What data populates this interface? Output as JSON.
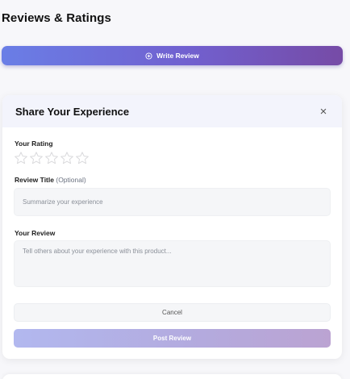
{
  "page": {
    "title": "Reviews & Ratings"
  },
  "write_review_button": {
    "label": "Write Review",
    "icon": "circle-plus-icon"
  },
  "review_form": {
    "title": "Share Your Experience",
    "close_icon": "close-icon",
    "close_glyph": "×",
    "rating": {
      "label": "Your Rating",
      "max_stars": 5,
      "selected": 0
    },
    "review_title": {
      "label": "Review Title",
      "optional_note": "(Optional)",
      "placeholder": "Summarize your experience",
      "value": ""
    },
    "review_body": {
      "label": "Your Review",
      "placeholder": "Tell others about your experience with this product...",
      "value": ""
    },
    "cancel_label": "Cancel",
    "submit_label": "Post Review"
  },
  "colors": {
    "accent_start": "#667eea",
    "accent_end": "#764ba2",
    "star_empty": "#d9d9dc"
  }
}
